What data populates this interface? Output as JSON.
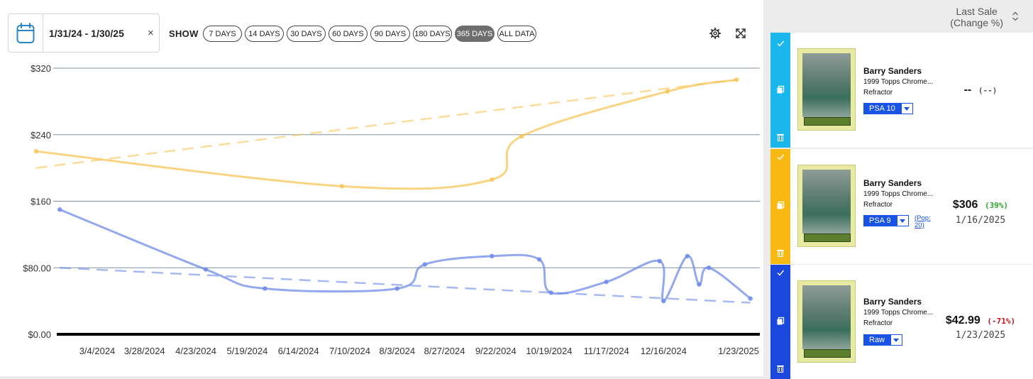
{
  "date_range": {
    "value": "1/31/24 - 1/30/25",
    "clear_icon": "×"
  },
  "show_label": "SHOW",
  "ranges": [
    {
      "label": "7 DAYS",
      "active": false
    },
    {
      "label": "14 DAYS",
      "active": false
    },
    {
      "label": "30 DAYS",
      "active": false
    },
    {
      "label": "60 DAYS",
      "active": false
    },
    {
      "label": "90 DAYS",
      "active": false
    },
    {
      "label": "180 DAYS",
      "active": false
    },
    {
      "label": "365 DAYS",
      "active": true
    },
    {
      "label": "ALL DATA",
      "active": false
    }
  ],
  "toolbar_icons": [
    "gear-icon",
    "expand-icon"
  ],
  "chart_data": {
    "type": "line",
    "ylim": [
      0,
      320
    ],
    "y_ticks": [
      "$0.00",
      "$80.00",
      "$160",
      "$240",
      "$320"
    ],
    "y_tick_values": [
      0,
      80,
      160,
      240,
      320
    ],
    "x_ticks": [
      "3/4/2024",
      "3/28/2024",
      "4/23/2024",
      "5/19/2024",
      "6/14/2024",
      "7/10/2024",
      "8/3/2024",
      "8/27/2024",
      "9/22/2024",
      "10/19/2024",
      "11/17/2024",
      "12/16/2024",
      "1/23/2025"
    ],
    "xlim": [
      "1/31/2024",
      "1/30/2025"
    ],
    "grid": true,
    "series": [
      {
        "color": "#f7c65a",
        "points": [
          [
            "2/2/2024",
            220
          ],
          [
            "7/6/2024",
            178
          ],
          [
            "9/20/2024",
            186
          ],
          [
            "10/5/2024",
            238
          ],
          [
            "12/18/2024",
            292
          ],
          [
            "1/22/2025",
            306
          ]
        ],
        "trend": [
          [
            "2/2/2024",
            200
          ],
          [
            "1/22/2025",
            306
          ]
        ]
      },
      {
        "color": "#6f8be8",
        "points": [
          [
            "2/14/2024",
            150
          ],
          [
            "4/28/2024",
            78
          ],
          [
            "5/28/2024",
            55
          ],
          [
            "8/3/2024",
            55
          ],
          [
            "8/17/2024",
            84
          ],
          [
            "9/20/2024",
            94
          ],
          [
            "10/14/2024",
            90
          ],
          [
            "10/20/2024",
            50
          ],
          [
            "11/17/2024",
            63
          ],
          [
            "12/14/2024",
            88
          ],
          [
            "12/16/2024",
            40
          ],
          [
            "12/28/2024",
            94
          ],
          [
            "1/3/2025",
            60
          ],
          [
            "1/8/2025",
            80
          ],
          [
            "1/29/2025",
            43
          ]
        ],
        "trend": [
          [
            "2/14/2024",
            80
          ],
          [
            "1/29/2025",
            38
          ]
        ]
      }
    ]
  },
  "list_header": {
    "line1": "Last Sale",
    "line2": "(Change %)"
  },
  "cards": [
    {
      "accent": "#19b7ec",
      "player": "Barry Sanders",
      "set": "1999 Topps Chrome...",
      "variant": "Refractor",
      "grade": "PSA 10",
      "pop": "",
      "price": "--",
      "change": "(--)",
      "change_color": "#555555",
      "date": ""
    },
    {
      "accent": "#f9b913",
      "player": "Barry Sanders",
      "set": "1999 Topps Chrome...",
      "variant": "Refractor",
      "grade": "PSA 9",
      "pop": "(Pop: 20)",
      "price": "$306",
      "change": "(39%)",
      "change_color": "#2aa52a",
      "date": "1/16/2025"
    },
    {
      "accent": "#1a47dc",
      "player": "Barry Sanders",
      "set": "1999 Topps Chrome...",
      "variant": "Refractor",
      "grade": "Raw",
      "pop": "",
      "price": "$42.99",
      "change": "(-71%)",
      "change_color": "#c0171f",
      "date": "1/23/2025"
    }
  ]
}
